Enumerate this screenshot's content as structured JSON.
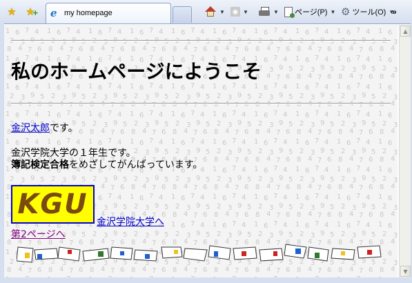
{
  "browser": {
    "tab_title": "my homepage",
    "page_menu_label": "ページ(P)",
    "tools_menu_label": "ツール(O)",
    "more_label": "»",
    "icons": [
      "favorites-star-icon",
      "add-favorites-icon",
      "ie-page-icon",
      "home-icon",
      "feeds-icon",
      "print-icon",
      "page-icon",
      "gear-icon"
    ]
  },
  "page": {
    "title": "私のホームページにようこそ",
    "name_link": "金沢太郎",
    "name_suffix": "です。",
    "school_line": "金沢学院大学の１年生です。",
    "goal_bold": "簿記検定合格",
    "goal_rest": "をめざしてがんばっています。",
    "logo_text": "KGU",
    "university_link": "金沢学院大学へ",
    "page2_link": "第2ページへ"
  },
  "colors": {
    "link": "#0000cc",
    "visited_link": "#800080",
    "logo_background": "#ffff00",
    "logo_text": "#7a4a10"
  }
}
